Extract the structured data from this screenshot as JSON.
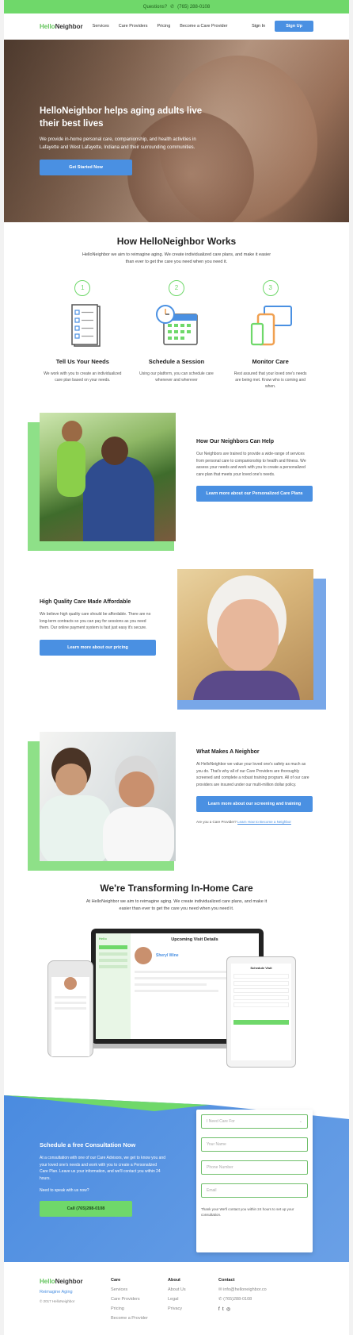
{
  "colors": {
    "green": "#6fd86a",
    "blue": "#4a90e2",
    "dark": "#222222"
  },
  "topbar": {
    "question": "Questions?",
    "phone_icon": "phone-icon",
    "phone": "(765) 288-0108"
  },
  "nav": {
    "logo_hello": "Hello",
    "logo_neighbor": "Neighbor",
    "links": [
      "Services",
      "Care Providers",
      "Pricing",
      "Become a Care Provider"
    ],
    "signin": "Sign In",
    "signup": "Sign Up"
  },
  "hero": {
    "title": "HelloNeighbor helps aging adults live their best lives",
    "subtitle": "We provide in-home personal care, companionship, and health activities in Lafayette and West Lafayette, Indiana and their surrounding communities.",
    "cta": "Get Started Now"
  },
  "how": {
    "title": "How HelloNeighbor Works",
    "subtitle": "HelloNeighbor we aim to reimagine aging. We create individualized care plans, and make it easier than ever to get the care you need when you need it.",
    "steps": [
      {
        "num": "1",
        "title": "Tell Us Your Needs",
        "desc": "We work with you to create an individualized care plan based on your needs."
      },
      {
        "num": "2",
        "title": "Schedule a Session",
        "desc": "Using our platform, you can schedule care whenever and wherever"
      },
      {
        "num": "3",
        "title": "Monitor Care",
        "desc": "Rest assured that your loved one's needs are being met. Know who is coming and when."
      }
    ]
  },
  "features": [
    {
      "title": "How Our Neighbors Can Help",
      "desc": "Our Neighbors are trained to provide a wide-range of services from personal care to companionship to health and fitness. We assess your needs and work with you to create a personalized care plan that meets your loved one's needs.",
      "cta": "Learn more about our Personalized Care Plans"
    },
    {
      "title": "High Quality Care Made Affordable",
      "desc": "We believe high quality care should be affordable. There are no long-term contracts so you can pay for sessions as you need them. Our online payment system is fast just easy it's secure.",
      "cta": "Learn more about our pricing"
    },
    {
      "title": "What Makes A Neighbor",
      "desc": "At HelloNeighbor we value your loved one's safety as much as you do. That's why all of our Care Providers are thoroughly screened and complete a robust training program. All of our care providers are insured under our multi-million dollar policy.",
      "cta": "Learn more about our screening and training",
      "provider_q": "Are you a Care Provider?",
      "provider_link": "Learn How to Become a Neighbor"
    }
  ],
  "transform": {
    "title": "We're Transforming In-Home Care",
    "subtitle": "At HelloNeighbor we aim to reimagine aging. We create individualized care plans, and make it easier than ever to get the care you need when you need it.",
    "laptop_header": "Upcoming Visit Details",
    "laptop_name": "Sheryl Wine",
    "tablet_header": "Schedule Visit"
  },
  "consult": {
    "title": "Schedule a free Consultation Now",
    "desc": "At a consultation with one of our Care Advisors, we get to know you and your loved one's needs and work with you to create a Personalized Care Plan. Leave us your information, and we'll contact you within 24 hours.",
    "question": "Need to speak with us now?",
    "call": "Call (765)288-0108"
  },
  "form": {
    "select": "I Need Care For",
    "name": "Your Name",
    "phone": "Phone Number",
    "email": "Email",
    "note": "Thank you! We'll contact you within 24 hours to set up your consultation."
  },
  "footer": {
    "logo_hello": "Hello",
    "logo_neighbor": "Neighbor",
    "tagline": "Reimagine Aging",
    "copyright": "© 2017 HelloNeighbor",
    "care_head": "Care",
    "care_links": [
      "Services",
      "Care Providers",
      "Pricing",
      "Become a Provider"
    ],
    "about_head": "About",
    "about_links": [
      "About Us",
      "Legal",
      "Privacy"
    ],
    "contact_head": "Contact",
    "email": "info@helloneighbor.co",
    "phone": "(765)288-0108",
    "social_icons": [
      "facebook-icon",
      "twitter-icon",
      "instagram-icon"
    ]
  }
}
